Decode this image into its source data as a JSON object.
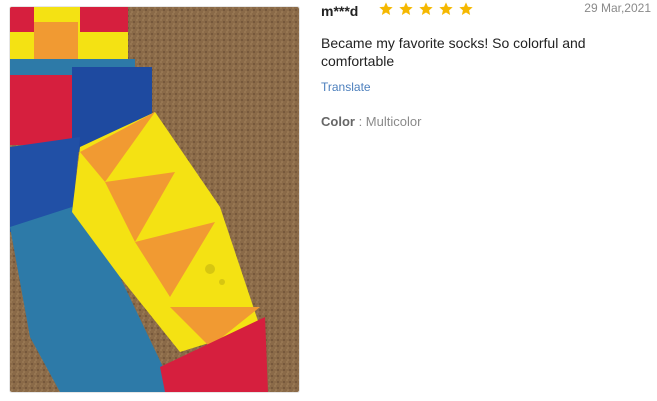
{
  "review": {
    "reviewer": "m***d",
    "rating": 5,
    "rating_max": 5,
    "date": "29 Mar,2021",
    "text": "Became my favorite socks! So colorful and comfortable",
    "translate_label": "Translate",
    "attribute_name": "Color",
    "attribute_separator": " : ",
    "attribute_value": "Multicolor"
  },
  "photo": {
    "icon": "review-photo",
    "subject": "socks"
  },
  "colors": {
    "star": "#f5b800",
    "link": "#4c7fbd",
    "sock_blue": "#2d7aa8",
    "sock_yellow": "#f4e213",
    "sock_orange": "#f19a32",
    "sock_red": "#d61f3e",
    "carpet": "#8a6a48"
  }
}
